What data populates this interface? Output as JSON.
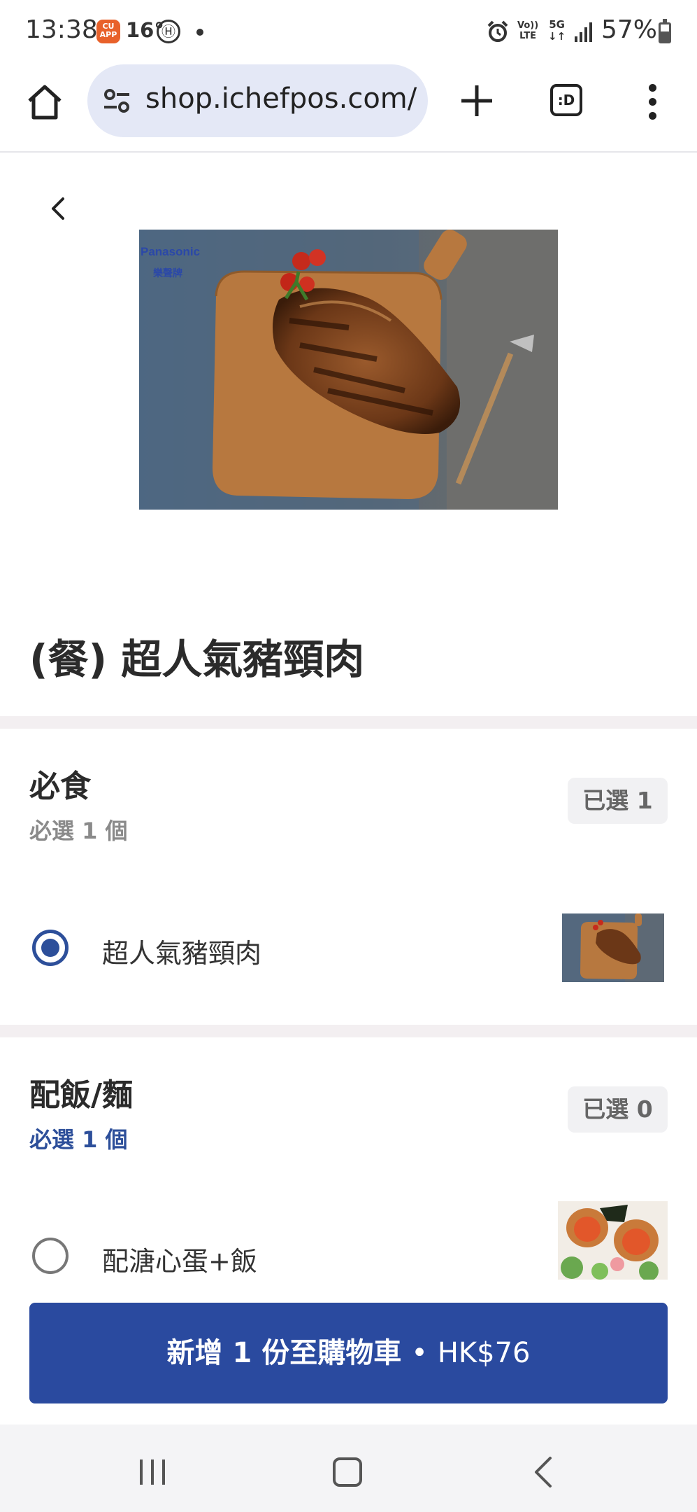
{
  "status_bar": {
    "time": "13:38",
    "app_badge": "CU APP",
    "temperature": "16°",
    "hk_icon": "Ⓗ",
    "volte": [
      "Vo))",
      "LTE"
    ],
    "network": [
      "5G",
      "↓↑"
    ],
    "battery_text": "57%",
    "battery_level": 0.57
  },
  "browser": {
    "url": "shop.ichefpos.com/s",
    "tabs_label": ":D"
  },
  "item": {
    "title": "(餐) 超人氣豬頸肉",
    "hero_brand": "Panasonic",
    "hero_brand_sub": "樂聲牌"
  },
  "groups": [
    {
      "title": "必食",
      "subtitle": "必選 1 個",
      "selected_badge": "已選 1",
      "options": [
        {
          "label": "超人氣豬頸肉",
          "checked": true
        }
      ]
    },
    {
      "title": "配飯/麵",
      "subtitle": "必選 1 個",
      "selected_badge": "已選 0",
      "options": [
        {
          "label": "配溏心蛋+飯",
          "checked": false
        }
      ]
    }
  ],
  "cart": {
    "label": "新增 1 份至購物車",
    "separator": "•",
    "price": "HK$76"
  },
  "colors": {
    "accent": "#2a4a9f",
    "divider": "#f3eff1",
    "url_pill": "#e4e8f6"
  }
}
